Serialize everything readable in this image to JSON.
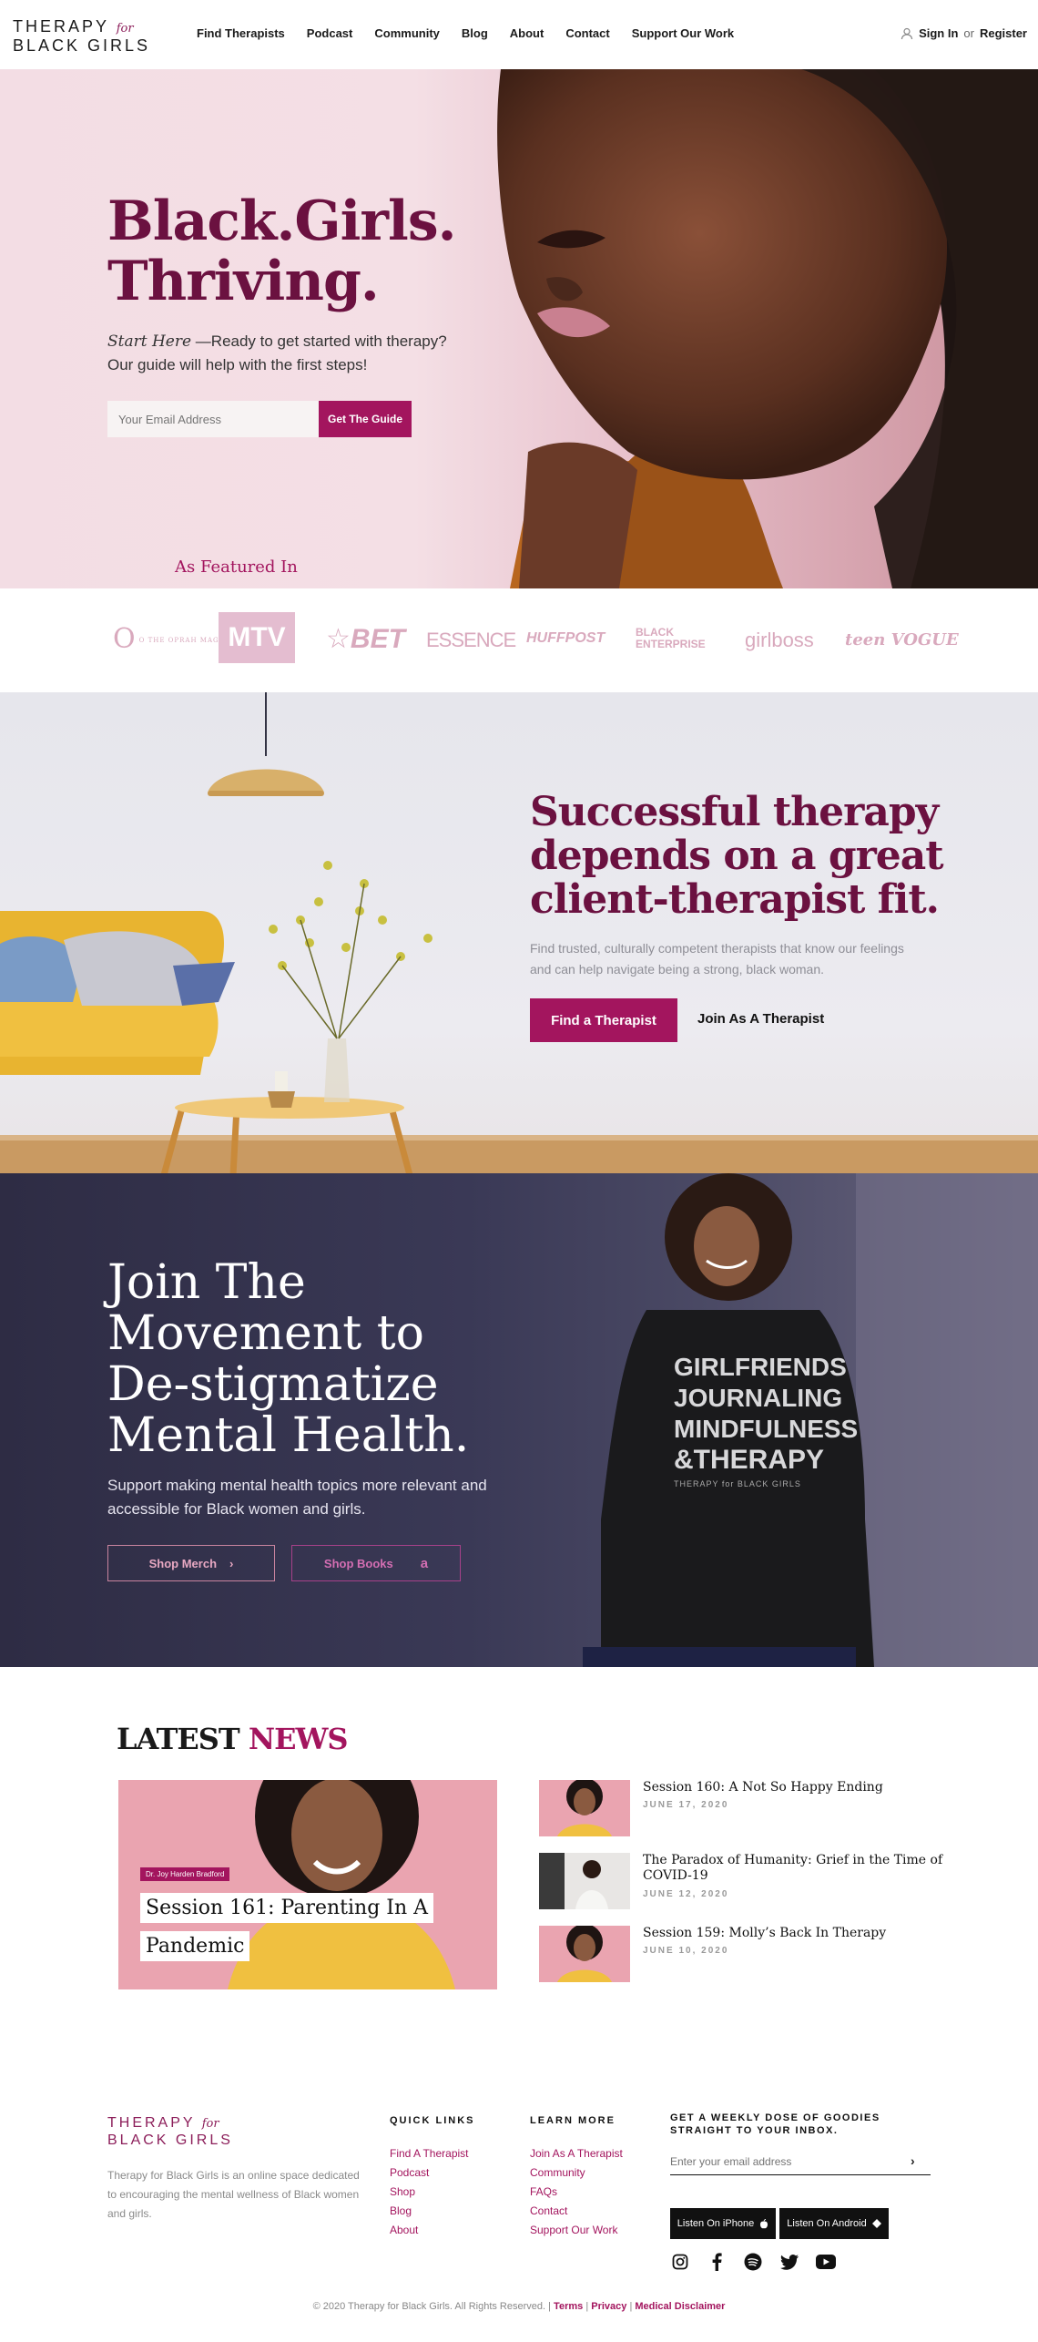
{
  "header": {
    "logo_line1": "THERAPY",
    "logo_for": "for",
    "logo_line2": "BLACK GIRLS",
    "nav": [
      "Find Therapists",
      "Podcast",
      "Community",
      "Blog",
      "About",
      "Contact",
      "Support Our Work"
    ],
    "sign_in": "Sign In",
    "or": "or",
    "register": "Register"
  },
  "hero": {
    "title_line1": "Black.Girls.",
    "title_line2": "Thriving.",
    "start_here": "Start Here",
    "subtitle_rest": " —Ready to get started with therapy? Our guide will help with the first steps!",
    "email_placeholder": "Your Email Address",
    "cta": "Get The Guide",
    "featured": "As Featured In"
  },
  "featured_logos": [
    "O THE OPRAH MAGAZINE",
    "MTV",
    "BET",
    "ESSENCE",
    "HUFFPOST",
    "BLACK ENTERPRISE",
    "girlboss",
    "teen VOGUE"
  ],
  "fit": {
    "title_line1": "Successful therapy",
    "title_line2": "depends on a great",
    "title_line3": "client-therapist fit.",
    "subtitle": "Find trusted, culturally competent therapists that know our feelings and can help navigate being a strong, black woman.",
    "primary": "Find a Therapist",
    "secondary": "Join As A Therapist"
  },
  "movement": {
    "title_line1": "Join The",
    "title_line2": "Movement to",
    "title_line3": "De-stigmatize",
    "title_line4": "Mental Health.",
    "subtitle": "Support making mental health topics more relevant and accessible for Black women and girls.",
    "merch": "Shop Merch",
    "books": "Shop Books",
    "shirt_l1": "GIRLFRIENDS",
    "shirt_l2": "JOURNALING",
    "shirt_l3": "MINDFULNESS",
    "shirt_l4": "&THERAPY",
    "shirt_brand": "THERAPY for BLACK GIRLS"
  },
  "news": {
    "heading_a": "LATEST",
    "heading_b": "NEWS",
    "feature_tag": "Dr. Joy Harden Bradford",
    "feature_title_line1": "Session 161: Parenting In A",
    "feature_title_line2": "Pandemic",
    "items": [
      {
        "title": "Session 160: A Not So Happy Ending",
        "date": "JUNE 17, 2020"
      },
      {
        "title": "The Paradox of Humanity: Grief in the Time of COVID-19",
        "date": "JUNE 12, 2020"
      },
      {
        "title": "Session 159: Molly’s Back In Therapy",
        "date": "JUNE 10, 2020"
      }
    ]
  },
  "footer": {
    "logo_line1": "THERAPY",
    "logo_for": "for",
    "logo_line2": "BLACK GIRLS",
    "description": "Therapy for Black Girls is an online space dedicated to encouraging the mental wellness of Black women and girls.",
    "quick_links_heading": "QUICK LINKS",
    "quick_links": [
      "Find A Therapist",
      "Podcast",
      "Shop",
      "Blog",
      "About"
    ],
    "learn_more_heading": "LEARN MORE",
    "learn_more": [
      "Join As A Therapist",
      "Community",
      "FAQs",
      "Contact",
      "Support Our Work"
    ],
    "newsletter_heading": "GET A WEEKLY DOSE OF GOODIES STRAIGHT TO YOUR INBOX.",
    "newsletter_placeholder": "Enter your email address",
    "iphone": "Listen On iPhone",
    "android": "Listen On Android",
    "copyright": "© 2020 Therapy for Black Girls. All Rights Reserved. |",
    "terms": "Terms",
    "privacy": "Privacy",
    "disclaimer": "Medical Disclaimer",
    "sep": "|"
  },
  "colors": {
    "brand": "#a3155e",
    "brand_dark": "#6b1140"
  },
  "icons": [
    "user-icon",
    "chevron-right-icon",
    "amazon-icon",
    "apple-icon",
    "android-icon",
    "instagram-icon",
    "facebook-icon",
    "spotify-icon",
    "twitter-icon",
    "youtube-icon"
  ]
}
